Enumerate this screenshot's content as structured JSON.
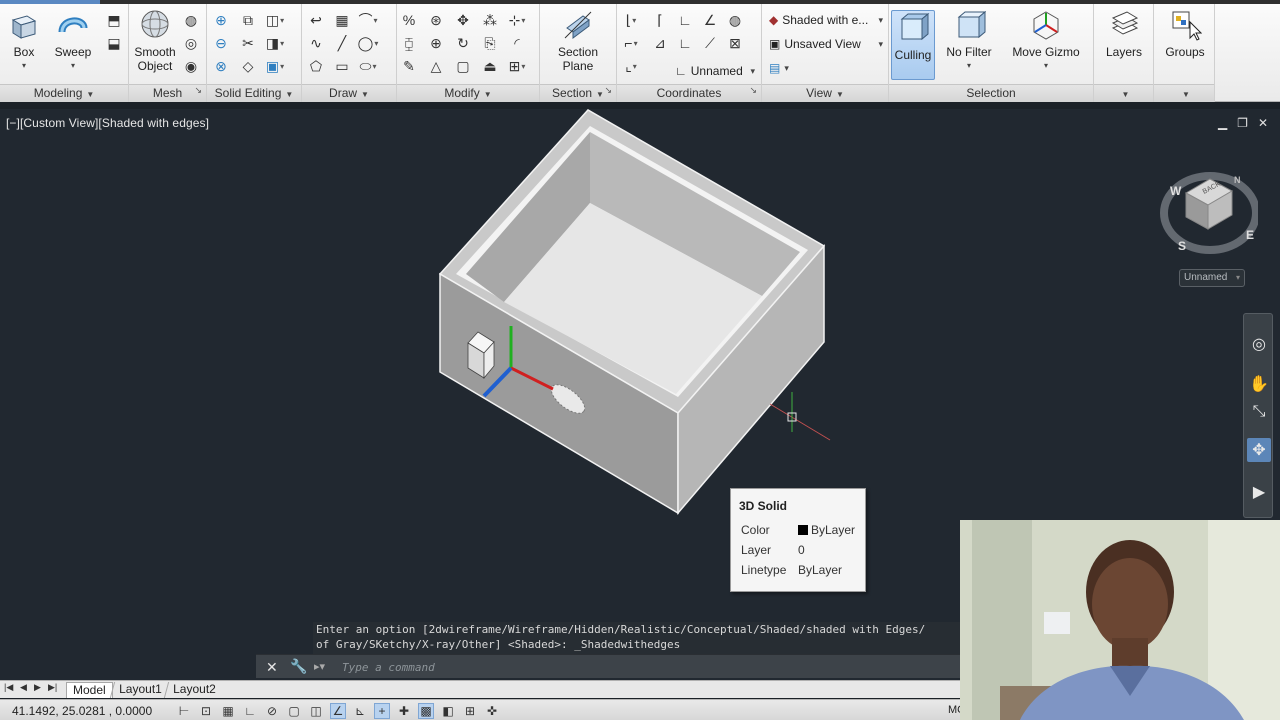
{
  "ribbon": {
    "panels": {
      "modeling": "Modeling",
      "mesh": "Mesh",
      "solid_editing": "Solid Editing",
      "draw": "Draw",
      "modify": "Modify",
      "section": "Section",
      "coordinates": "Coordinates",
      "view": "View",
      "selection": "Selection"
    },
    "buttons": {
      "box": "Box",
      "sweep": "Sweep",
      "smooth_object_1": "Smooth",
      "smooth_object_2": "Object",
      "section_plane_1": "Section",
      "section_plane_2": "Plane",
      "culling": "Culling",
      "no_filter": "No Filter",
      "move_gizmo": "Move Gizmo",
      "layers": "Layers",
      "groups": "Groups"
    },
    "combos": {
      "visual_style": "Shaded with e...",
      "named_view": "Unsaved View",
      "ucs": "Unnamed"
    }
  },
  "viewport": {
    "label": "[−][Custom View][Shaded with edges]",
    "viewcube_ucs": "Unnamed",
    "viewcube_face": "BACK",
    "compass": {
      "w": "W",
      "s": "S",
      "e": "E",
      "n": "N"
    }
  },
  "tooltip": {
    "title": "3D Solid",
    "rows": [
      {
        "key": "Color",
        "value": "ByLayer"
      },
      {
        "key": "Layer",
        "value": "0"
      },
      {
        "key": "Linetype",
        "value": "ByLayer"
      }
    ]
  },
  "command": {
    "history_1": "Enter an option [2dwireframe/Wireframe/Hidden/Realistic/Conceptual/Shaded/shaded with Edges/",
    "history_2": "of Gray/SKetchy/X-ray/Other] <Shaded>: _Shadedwithedges",
    "placeholder": "Type a command"
  },
  "layout_tabs": {
    "model": "Model",
    "layout1": "Layout1",
    "layout2": "Layout2"
  },
  "status": {
    "coordinates": "41.1492, 25.0281 , 0.0000",
    "model_space": "MO"
  },
  "colors": {
    "accent": "#5c86b8",
    "viewport_bg": "#212830",
    "x_axis": "#d02020",
    "y_axis": "#20a020",
    "z_axis": "#2060d0"
  }
}
